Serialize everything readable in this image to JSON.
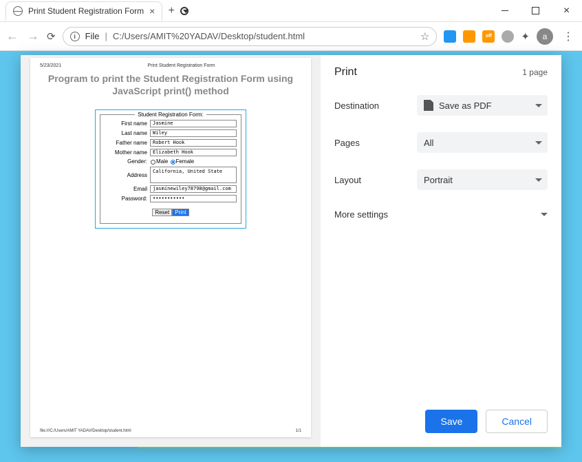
{
  "window": {
    "tab_title": "Print Student Registration Form",
    "url_prefix": "File",
    "url_path": "C:/Users/AMIT%20YADAV/Desktop/student.html",
    "avatar_letter": "a",
    "ext_off": "off"
  },
  "print": {
    "title": "Print",
    "page_count": "1 page",
    "destination_label": "Destination",
    "destination_value": "Save as PDF",
    "pages_label": "Pages",
    "pages_value": "All",
    "layout_label": "Layout",
    "layout_value": "Portrait",
    "more_label": "More settings",
    "save": "Save",
    "cancel": "Cancel"
  },
  "preview": {
    "date": "5/23/2021",
    "header_title": "Print Student Registration Form",
    "heading": "Program to print the Student Registration Form using JavaScript print() method",
    "legend": "Student Registration Form:",
    "first_name_label": "First name",
    "first_name": "Jasmine",
    "last_name_label": "Last name",
    "last_name": "Wiley",
    "father_label": "Father name",
    "father": "Robert Hook",
    "mother_label": "Mother name",
    "mother": "Elizabeth Hook",
    "gender_label": "Gender:",
    "male": "Male",
    "female": "Female",
    "address_label": "Address",
    "address": "California, United State",
    "email_label": "Email",
    "email": "jasminewiley78798@gmail.com",
    "password_label": "Password:",
    "password": "•••••••••••",
    "reset": "Reset",
    "print_btn": "Print",
    "footer_path": "file:///C:/Users/AMIT YADAV/Desktop/student.html",
    "footer_page": "1/1"
  }
}
